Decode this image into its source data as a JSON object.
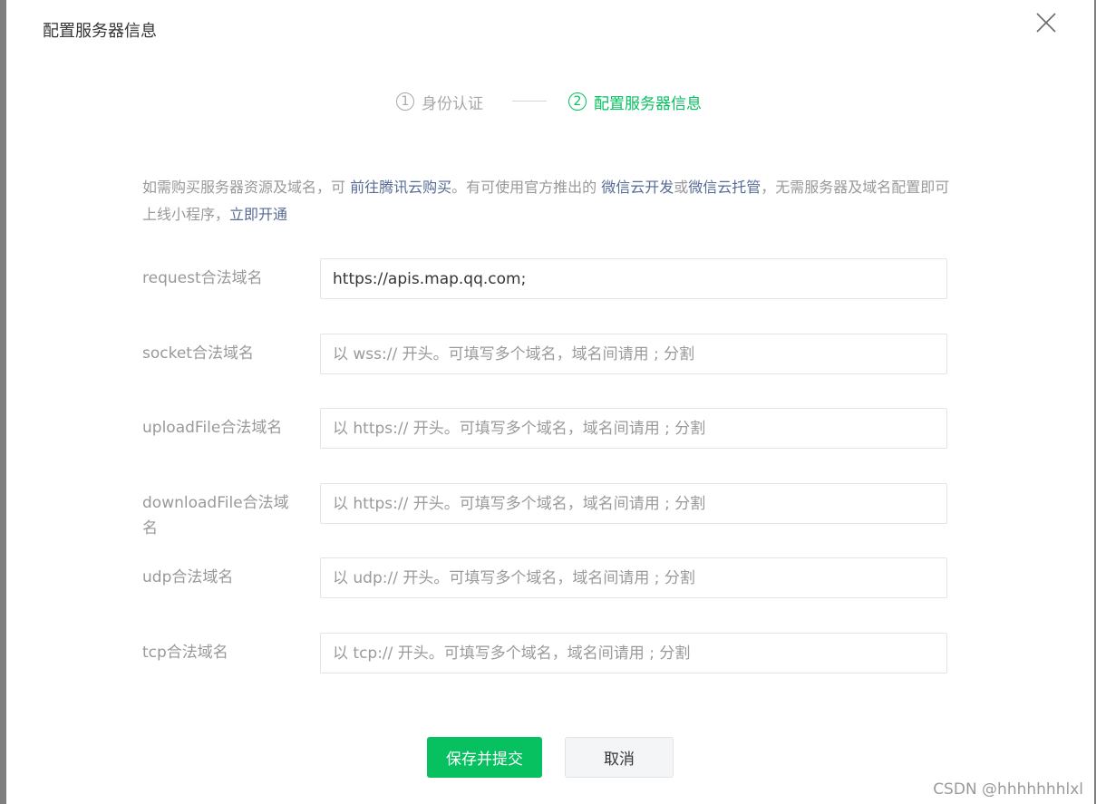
{
  "dialog": {
    "title": "配置服务器信息",
    "close_icon": "close-icon"
  },
  "steps": [
    {
      "num": "1",
      "label": "身份认证",
      "state": "done"
    },
    {
      "num": "2",
      "label": "配置服务器信息",
      "state": "active"
    }
  ],
  "intro": {
    "text1": "如需购买服务器资源及域名，可 ",
    "link1": "前往腾讯云购买",
    "text2": "。有可使用官方推出的 ",
    "link2": "微信云开发",
    "text3": "或",
    "link3": "微信云托管",
    "text4": "，无需服务器及域名配置即可上线小程序，",
    "link4": "立即开通"
  },
  "fields": [
    {
      "label": "request合法域名",
      "value": "https://apis.map.qq.com;",
      "placeholder": ""
    },
    {
      "label": "socket合法域名",
      "value": "",
      "placeholder": "以 wss:// 开头。可填写多个域名，域名间请用 ; 分割"
    },
    {
      "label": "uploadFile合法域名",
      "value": "",
      "placeholder": "以 https:// 开头。可填写多个域名，域名间请用 ; 分割"
    },
    {
      "label": "downloadFile合法域名",
      "value": "",
      "placeholder": "以 https:// 开头。可填写多个域名，域名间请用 ; 分割"
    },
    {
      "label": "udp合法域名",
      "value": "",
      "placeholder": "以 udp:// 开头。可填写多个域名，域名间请用 ; 分割"
    },
    {
      "label": "tcp合法域名",
      "value": "",
      "placeholder": "以 tcp:// 开头。可填写多个域名，域名间请用 ; 分割"
    }
  ],
  "buttons": {
    "submit": "保存并提交",
    "cancel": "取消"
  },
  "watermark": "CSDN @hhhhhhhlxl",
  "colors": {
    "accent": "#07c160",
    "link": "#576b95",
    "muted": "#999999"
  }
}
